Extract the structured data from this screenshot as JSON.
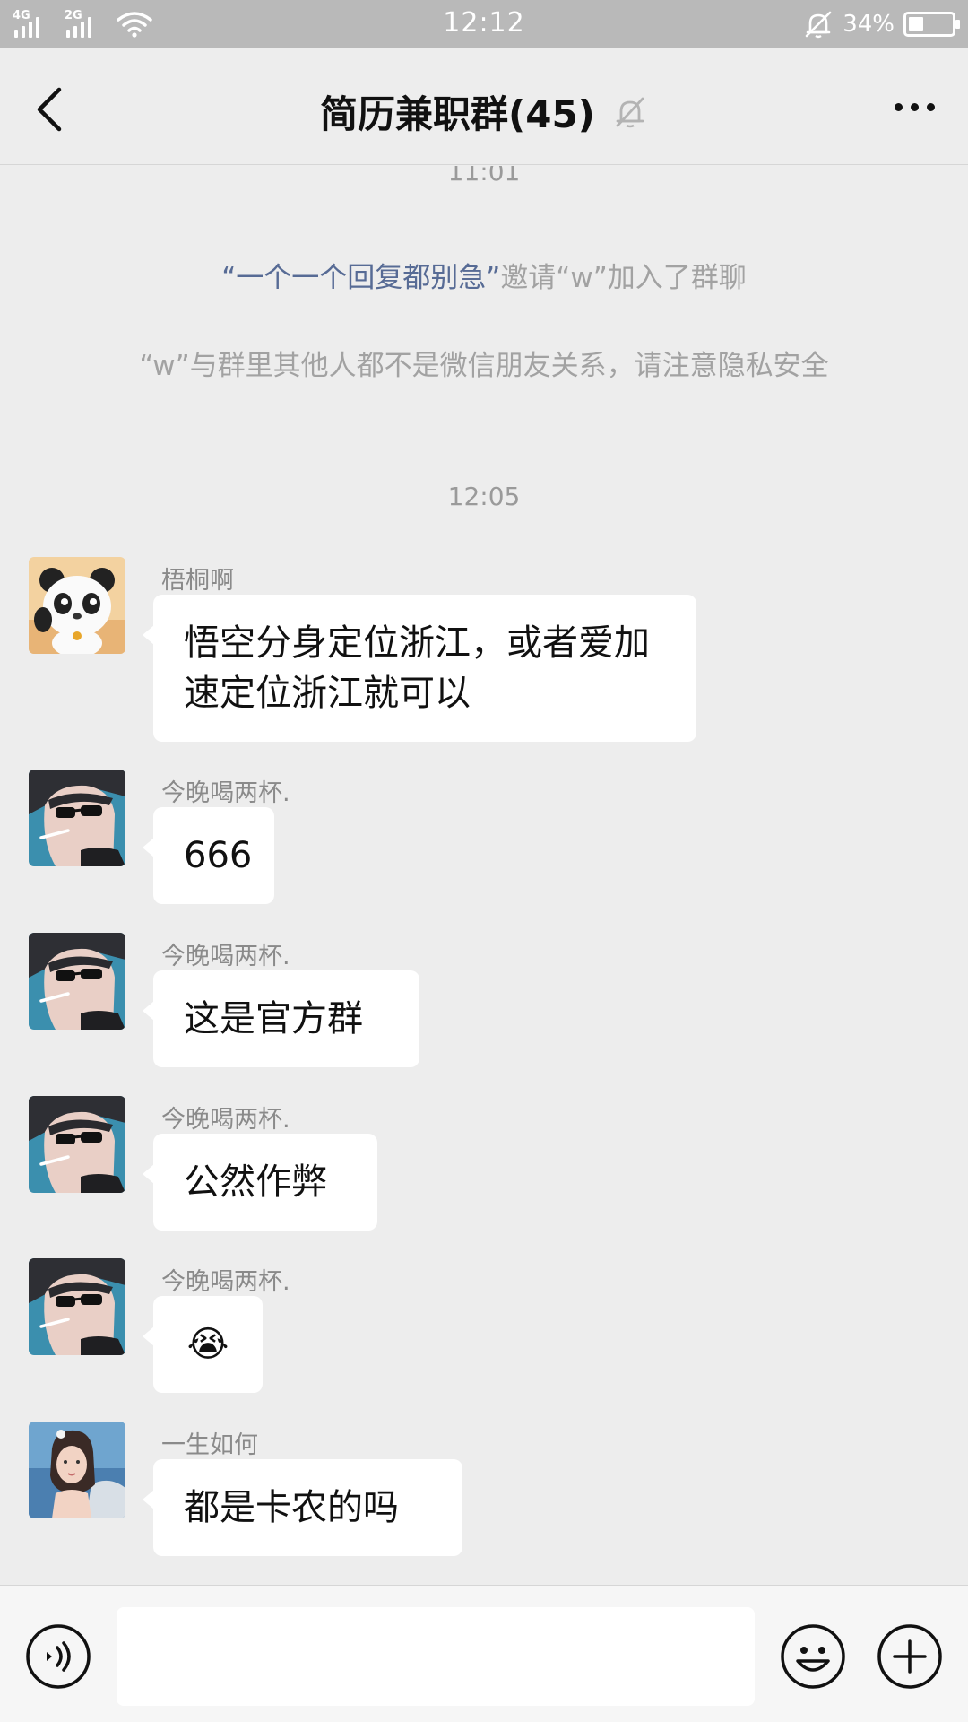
{
  "status_bar": {
    "network_1": "4G",
    "network_2": "2G",
    "time": "12:12",
    "battery_pct": "34%",
    "battery_level": 0.34
  },
  "header": {
    "title": "简历兼职群(45)"
  },
  "timeline": {
    "time_top": "11:01",
    "system_invite": {
      "inviter": "“一个一个回复都别急”",
      "text": "邀请“w”加入了群聊"
    },
    "system_privacy": "“w”与群里其他人都不是微信朋友关系，请注意隐私安全",
    "time_mid": "12:05"
  },
  "messages": [
    {
      "sender": "梧桐啊",
      "text": "悟空分身定位浙江，或者爱加速定位浙江就可以",
      "avatar": "panda-avatar"
    },
    {
      "sender": "今晚喝两杯.",
      "text": "666",
      "avatar": "sunglasses-avatar"
    },
    {
      "sender": "今晚喝两杯.",
      "text": "这是官方群",
      "avatar": "sunglasses-avatar"
    },
    {
      "sender": "今晚喝两杯.",
      "text": "公然作弊",
      "avatar": "sunglasses-avatar"
    },
    {
      "sender": "今晚喝两杯.",
      "text": "😭",
      "avatar": "sunglasses-avatar"
    },
    {
      "sender": "一生如何",
      "text": "都是卡农的吗",
      "avatar": "girl-avatar"
    }
  ],
  "input_bar": {
    "placeholder": ""
  }
}
